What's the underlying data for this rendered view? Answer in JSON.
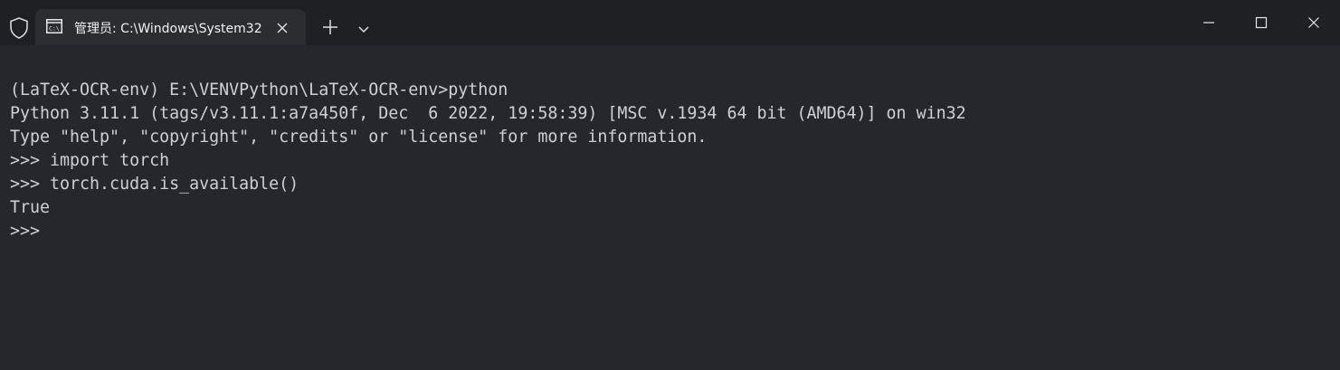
{
  "tab": {
    "title": "管理员: C:\\Windows\\System32",
    "icon": "cmd-icon"
  },
  "titlebar": {
    "shield_icon": "shield-icon",
    "new_tab_icon": "plus-icon",
    "dropdown_icon": "chevron-down-icon",
    "minimize_icon": "minimize-icon",
    "maximize_icon": "maximize-icon",
    "close_icon": "close-icon"
  },
  "terminal": {
    "lines": [
      "(LaTeX-OCR-env) E:\\VENVPython\\LaTeX-OCR-env>python",
      "Python 3.11.1 (tags/v3.11.1:a7a450f, Dec  6 2022, 19:58:39) [MSC v.1934 64 bit (AMD64)] on win32",
      "Type \"help\", \"copyright\", \"credits\" or \"license\" for more information.",
      ">>> import torch",
      ">>> torch.cuda.is_available()",
      "True",
      ">>>"
    ]
  },
  "colors": {
    "terminal_bg": "#25272c",
    "titlebar_bg": "#1f2024",
    "tab_bg": "#2b2d31",
    "text": "#cfd0d2"
  }
}
